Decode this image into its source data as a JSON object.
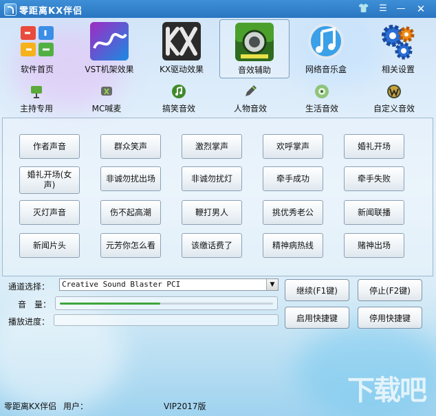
{
  "window": {
    "title": "零距离KX伴侣"
  },
  "nav": [
    {
      "label": "软件首页",
      "icon": "office-grid-icon"
    },
    {
      "label": "VST机架效果",
      "icon": "vst-rack-icon"
    },
    {
      "label": "KX驱动效果",
      "icon": "kx-driver-icon"
    },
    {
      "label": "音效辅助",
      "icon": "speaker-icon"
    },
    {
      "label": "网络音乐盒",
      "icon": "music-note-icon"
    },
    {
      "label": "相关设置",
      "icon": "gears-icon"
    }
  ],
  "subnav": [
    {
      "label": "主持专用",
      "icon": "presentation-icon"
    },
    {
      "label": "MC喊麦",
      "icon": "mic-icon"
    },
    {
      "label": "搞笑音效",
      "icon": "note-icon"
    },
    {
      "label": "人物音效",
      "icon": "pen-icon"
    },
    {
      "label": "生活音效",
      "icon": "media-icon"
    },
    {
      "label": "自定义音效",
      "icon": "w-icon"
    }
  ],
  "sounds": [
    "作者声音",
    "群众笑声",
    "激烈掌声",
    "欢呼掌声",
    "婚礼开场",
    "婚礼开场(女声)",
    "非诚勿扰出场",
    "非诚勿扰灯",
    "牵手成功",
    "牵手失败",
    "灭灯声音",
    "伤不起高潮",
    "鞭打男人",
    "挑优秀老公",
    "新闻联播",
    "新闻片头",
    "元芳你怎么看",
    "该缴话费了",
    "精神病热线",
    "赌神出场"
  ],
  "controls": {
    "channel_label": "通道选择：",
    "channel_value": "Creative Sound Blaster PCI",
    "volume_label": "音　量：",
    "volume_level": 0.47,
    "progress_label": "播放进度：",
    "progress_level": 0,
    "continue_btn": "继续(F1键)",
    "stop_btn": "停止(F2键)",
    "enable_hotkey_btn": "启用快捷键",
    "disable_hotkey_btn": "停用快捷键"
  },
  "status": {
    "app_name": "零距离KX伴侣",
    "user_label": "用户：",
    "version": "VIP2017版"
  },
  "watermark": "下载吧"
}
